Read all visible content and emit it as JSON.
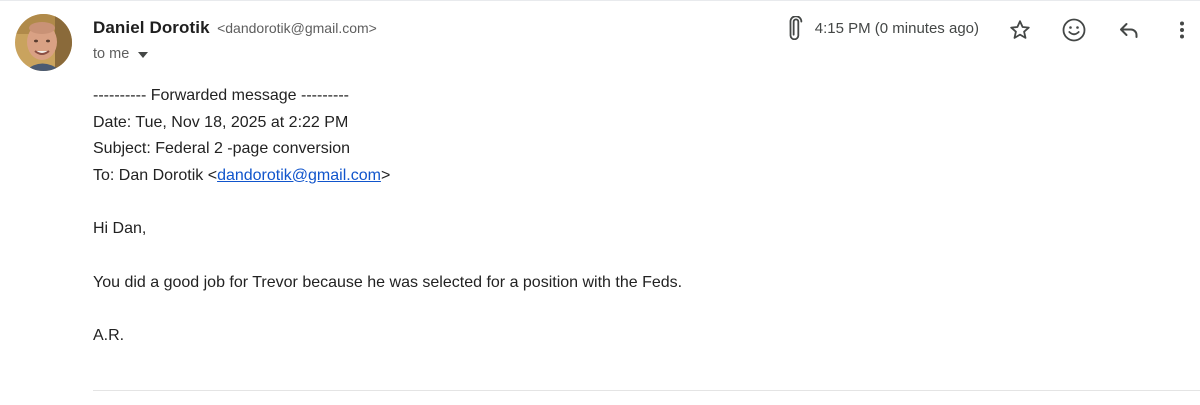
{
  "sender": {
    "name": "Daniel Dorotik",
    "email": "<dandorotik@gmail.com>"
  },
  "recipient": {
    "label": "to me"
  },
  "header": {
    "timestamp": "4:15 PM (0 minutes ago)",
    "icons": [
      "attachment-icon",
      "star-icon",
      "emoji-icon",
      "reply-icon",
      "more-vert-icon"
    ]
  },
  "forwarded": {
    "separator": "---------- Forwarded message ---------",
    "date": "Date: Tue, Nov 18, 2025 at 2:22 PM",
    "subject": "Subject: Federal 2 -page conversion",
    "to_prefix": "To: Dan Dorotik <",
    "to_email": "dandorotik@gmail.com",
    "to_suffix": ">"
  },
  "message": {
    "greeting": "Hi Dan,",
    "body": "You did a good job for Trevor because he was selected for a position with the Feds.",
    "signature": "A.R."
  },
  "colors": {
    "link": "#1155cc",
    "muted_text": "#5e5e5e",
    "body_text": "#222222"
  }
}
